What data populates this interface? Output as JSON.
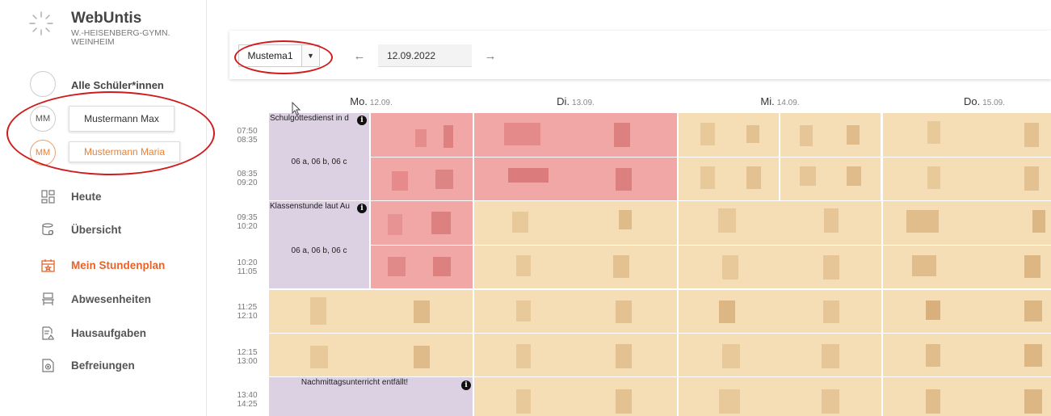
{
  "app": {
    "brand": "WebUntis",
    "school_line1": "W.-HEISENBERG-GYMN.",
    "school_line2": "WEINHEIM"
  },
  "students": {
    "all_label": "Alle Schüler*innen",
    "list": [
      {
        "initials": "MM",
        "name": "Mustermann Max",
        "active": false
      },
      {
        "initials": "MM",
        "name": "Mustermann Maria",
        "active": true
      }
    ]
  },
  "nav": {
    "items": [
      {
        "label": "Heute",
        "icon": "dashboard-icon",
        "active": false
      },
      {
        "label": "Übersicht",
        "icon": "overview-icon",
        "active": false
      },
      {
        "label": "Mein Stundenplan",
        "icon": "calendar-icon",
        "active": true
      },
      {
        "label": "Abwesenheiten",
        "icon": "chair-icon",
        "active": false
      },
      {
        "label": "Hausaufgaben",
        "icon": "homework-icon",
        "active": false
      },
      {
        "label": "Befreiungen",
        "icon": "exemption-icon",
        "active": false
      }
    ]
  },
  "toolbar": {
    "class_value": "Mustema1",
    "caret": "▼",
    "prev_arrow": "←",
    "next_arrow": "→",
    "date_value": "12.09.2022"
  },
  "timetable": {
    "days": [
      {
        "name": "Mo.",
        "date": "12.09."
      },
      {
        "name": "Di.",
        "date": "13.09."
      },
      {
        "name": "Mi.",
        "date": "14.09."
      },
      {
        "name": "Do.",
        "date": "15.09."
      }
    ],
    "periods": [
      {
        "start": "07:50",
        "end": "08:35"
      },
      {
        "start": "08:35",
        "end": "09:20"
      },
      {
        "start": "09:35",
        "end": "10:20"
      },
      {
        "start": "10:20",
        "end": "11:05"
      },
      {
        "start": "11:25",
        "end": "12:10"
      },
      {
        "start": "12:15",
        "end": "13:00"
      },
      {
        "start": "13:40",
        "end": "14:25"
      }
    ],
    "events": {
      "schulgottesdienst": "Schulgottesdienst in d",
      "classes_1": "06 a, 06 b, 06 c",
      "klassenstunde": "Klassenstunde laut Au",
      "classes_2": "06 a, 06 b, 06 c",
      "nachmittag": "Nachmittagsunterricht entfällt!",
      "info_glyph": "i"
    },
    "colors": {
      "purple": "#dcd0e3",
      "red": "#f2a7a7",
      "beige": "#f5ddb6",
      "accent": "#e8632a",
      "annotation": "#d01c1c"
    }
  }
}
